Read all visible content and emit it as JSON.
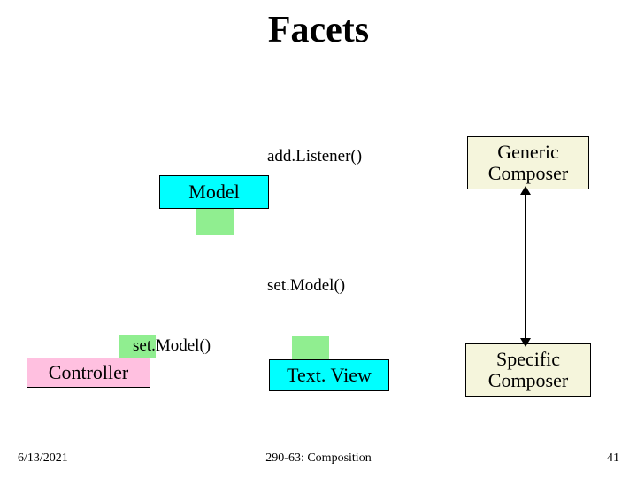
{
  "title": "Facets",
  "labels": {
    "addListener": "add.Listener()",
    "setModelCenter": "set.Model()",
    "setModelLeft": "set.Model()"
  },
  "boxes": {
    "model": "Model",
    "genericLine1": "Generic",
    "genericLine2": "Composer",
    "controller": "Controller",
    "textView": "Text. View",
    "specificLine1": "Specific",
    "specificLine2": "Composer"
  },
  "footer": {
    "date": "6/13/2021",
    "center": "290-63: Composition",
    "page": "41"
  },
  "chart_data": {
    "type": "diagram",
    "title": "Facets",
    "nodes": [
      {
        "id": "model",
        "label": "Model",
        "color": "#00ffff"
      },
      {
        "id": "generic_composer",
        "label": "Generic Composer",
        "color": "#f5f5dc"
      },
      {
        "id": "controller",
        "label": "Controller",
        "color": "#ffc0e0"
      },
      {
        "id": "text_view",
        "label": "Text. View",
        "color": "#00ffff"
      },
      {
        "id": "specific_composer",
        "label": "Specific Composer",
        "color": "#f5f5dc"
      }
    ],
    "edges": [
      {
        "from": "generic_composer",
        "to": "specific_composer",
        "style": "bidirectional"
      }
    ],
    "annotations": [
      {
        "text": "add.Listener()",
        "near": "model"
      },
      {
        "text": "set.Model()",
        "near": "center"
      },
      {
        "text": "set.Model()",
        "near": "controller"
      }
    ],
    "ports": [
      {
        "node": "model",
        "color": "#90ee90"
      },
      {
        "node": "controller",
        "color": "#90ee90"
      },
      {
        "node": "text_view",
        "color": "#90ee90"
      }
    ]
  }
}
